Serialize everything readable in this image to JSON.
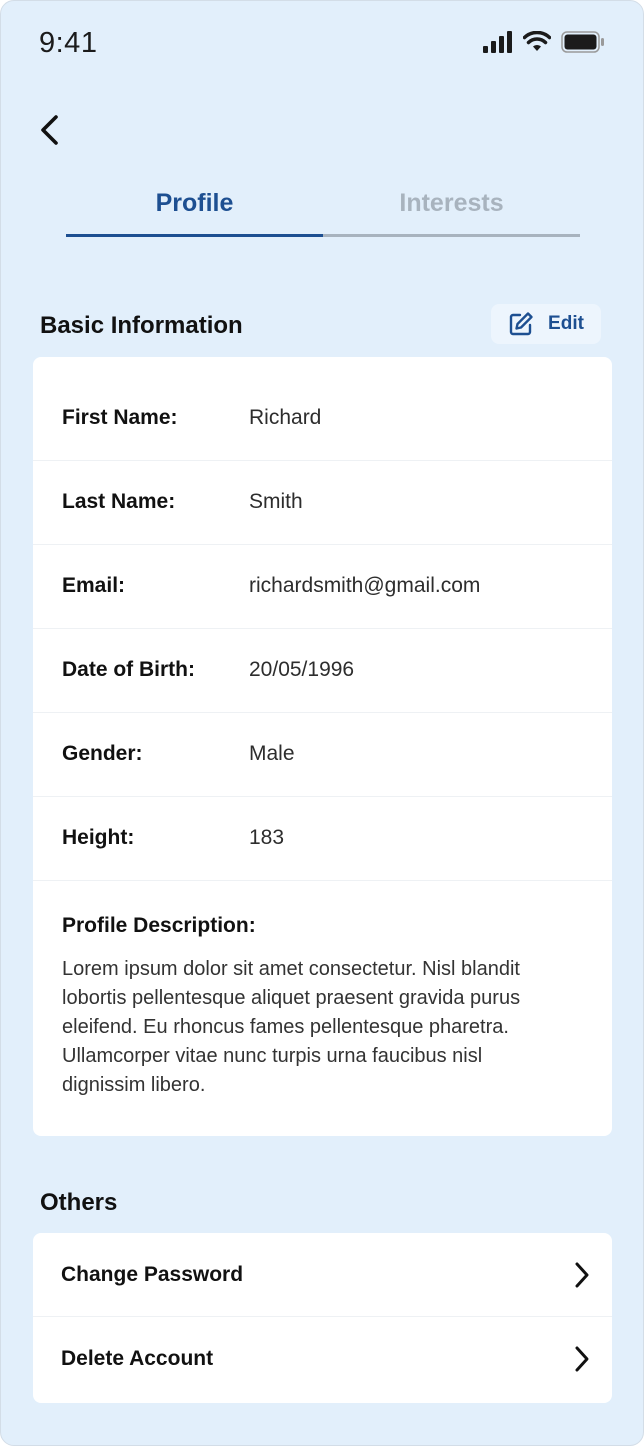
{
  "status_bar": {
    "time": "9:41",
    "icons": [
      "signal-icon",
      "wifi-icon",
      "battery-icon"
    ]
  },
  "nav": {
    "back_icon": "chevron-left-icon"
  },
  "tabs": [
    {
      "label": "Profile",
      "active": true
    },
    {
      "label": "Interests",
      "active": false
    }
  ],
  "basic_info": {
    "title": "Basic Information",
    "edit_label": "Edit",
    "edit_icon": "edit-icon",
    "fields": [
      {
        "label": "First Name:",
        "value": "Richard"
      },
      {
        "label": "Last Name:",
        "value": "Smith"
      },
      {
        "label": "Email:",
        "value": "richardsmith@gmail.com"
      },
      {
        "label": "Date of Birth:",
        "value": "20/05/1996"
      },
      {
        "label": "Gender:",
        "value": "Male"
      },
      {
        "label": "Height:",
        "value": "183"
      }
    ],
    "description_label": "Profile Description:",
    "description": "Lorem ipsum dolor sit amet consectetur. Nisl blandit lobortis pellentesque aliquet praesent gravida purus eleifend. Eu rhoncus fames pellentesque pharetra. Ullamcorper vitae nunc turpis urna faucibus nisl dignissim libero."
  },
  "others": {
    "title": "Others",
    "items": [
      {
        "label": "Change Password"
      },
      {
        "label": "Delete Account"
      }
    ]
  },
  "colors": {
    "background": "#e2effb",
    "accent": "#1d4f91",
    "inactive_tab": "#a8b3be",
    "card": "#ffffff"
  }
}
